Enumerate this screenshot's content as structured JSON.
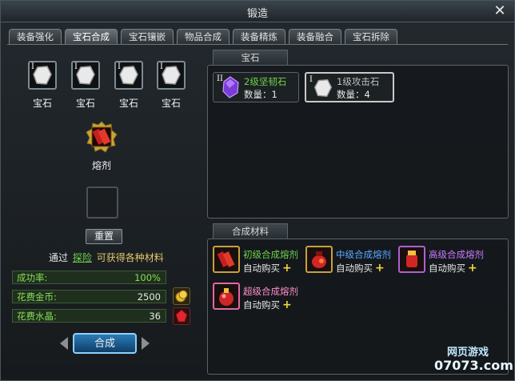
{
  "window": {
    "title": "锻造",
    "close_glyph": "✕"
  },
  "tabs": [
    {
      "label": "装备强化"
    },
    {
      "label": "宝石合成"
    },
    {
      "label": "宝石镶嵌"
    },
    {
      "label": "物品合成"
    },
    {
      "label": "装备精炼"
    },
    {
      "label": "装备融合"
    },
    {
      "label": "宝石拆除"
    }
  ],
  "active_tab": "宝石合成",
  "left": {
    "gem_slots": [
      {
        "label": "宝石",
        "roman": "I"
      },
      {
        "label": "宝石",
        "roman": "I"
      },
      {
        "label": "宝石",
        "roman": "I"
      },
      {
        "label": "宝石",
        "roman": "I"
      }
    ],
    "flux_label": "熔剂",
    "reset_label": "重置",
    "explore_text_1": "通过",
    "explore_link": "探险",
    "explore_text_2": "可获得各种材料",
    "stats": [
      {
        "label": "成功率:",
        "value": "100%"
      },
      {
        "label": "花费金币:",
        "value": "2500"
      },
      {
        "label": "花费水晶:",
        "value": "36"
      }
    ],
    "compose_label": "合成"
  },
  "gem_panel": {
    "header": "宝石",
    "items": [
      {
        "roman": "II",
        "name": "2级坚韧石",
        "qty": "数量：1",
        "name_color": "#6fd24a"
      },
      {
        "roman": "I",
        "name": "1级攻击石",
        "qty": "数量：4",
        "name_color": "#bfbfbf"
      }
    ]
  },
  "material_panel": {
    "header": "合成材料",
    "items": [
      {
        "name": "初级合成熔剂",
        "sub": "自动购买",
        "name_color": "#6fd24a"
      },
      {
        "name": "中级合成熔剂",
        "sub": "自动购买",
        "name_color": "#57a9ff"
      },
      {
        "name": "高级合成熔剂",
        "sub": "自动购买",
        "name_color": "#c77bff"
      },
      {
        "name": "超级合成熔剂",
        "sub": "自动购买",
        "name_color": "#ff8fc8"
      }
    ]
  },
  "watermark": {
    "line1": "网页游戏",
    "line2": "07073.com"
  }
}
